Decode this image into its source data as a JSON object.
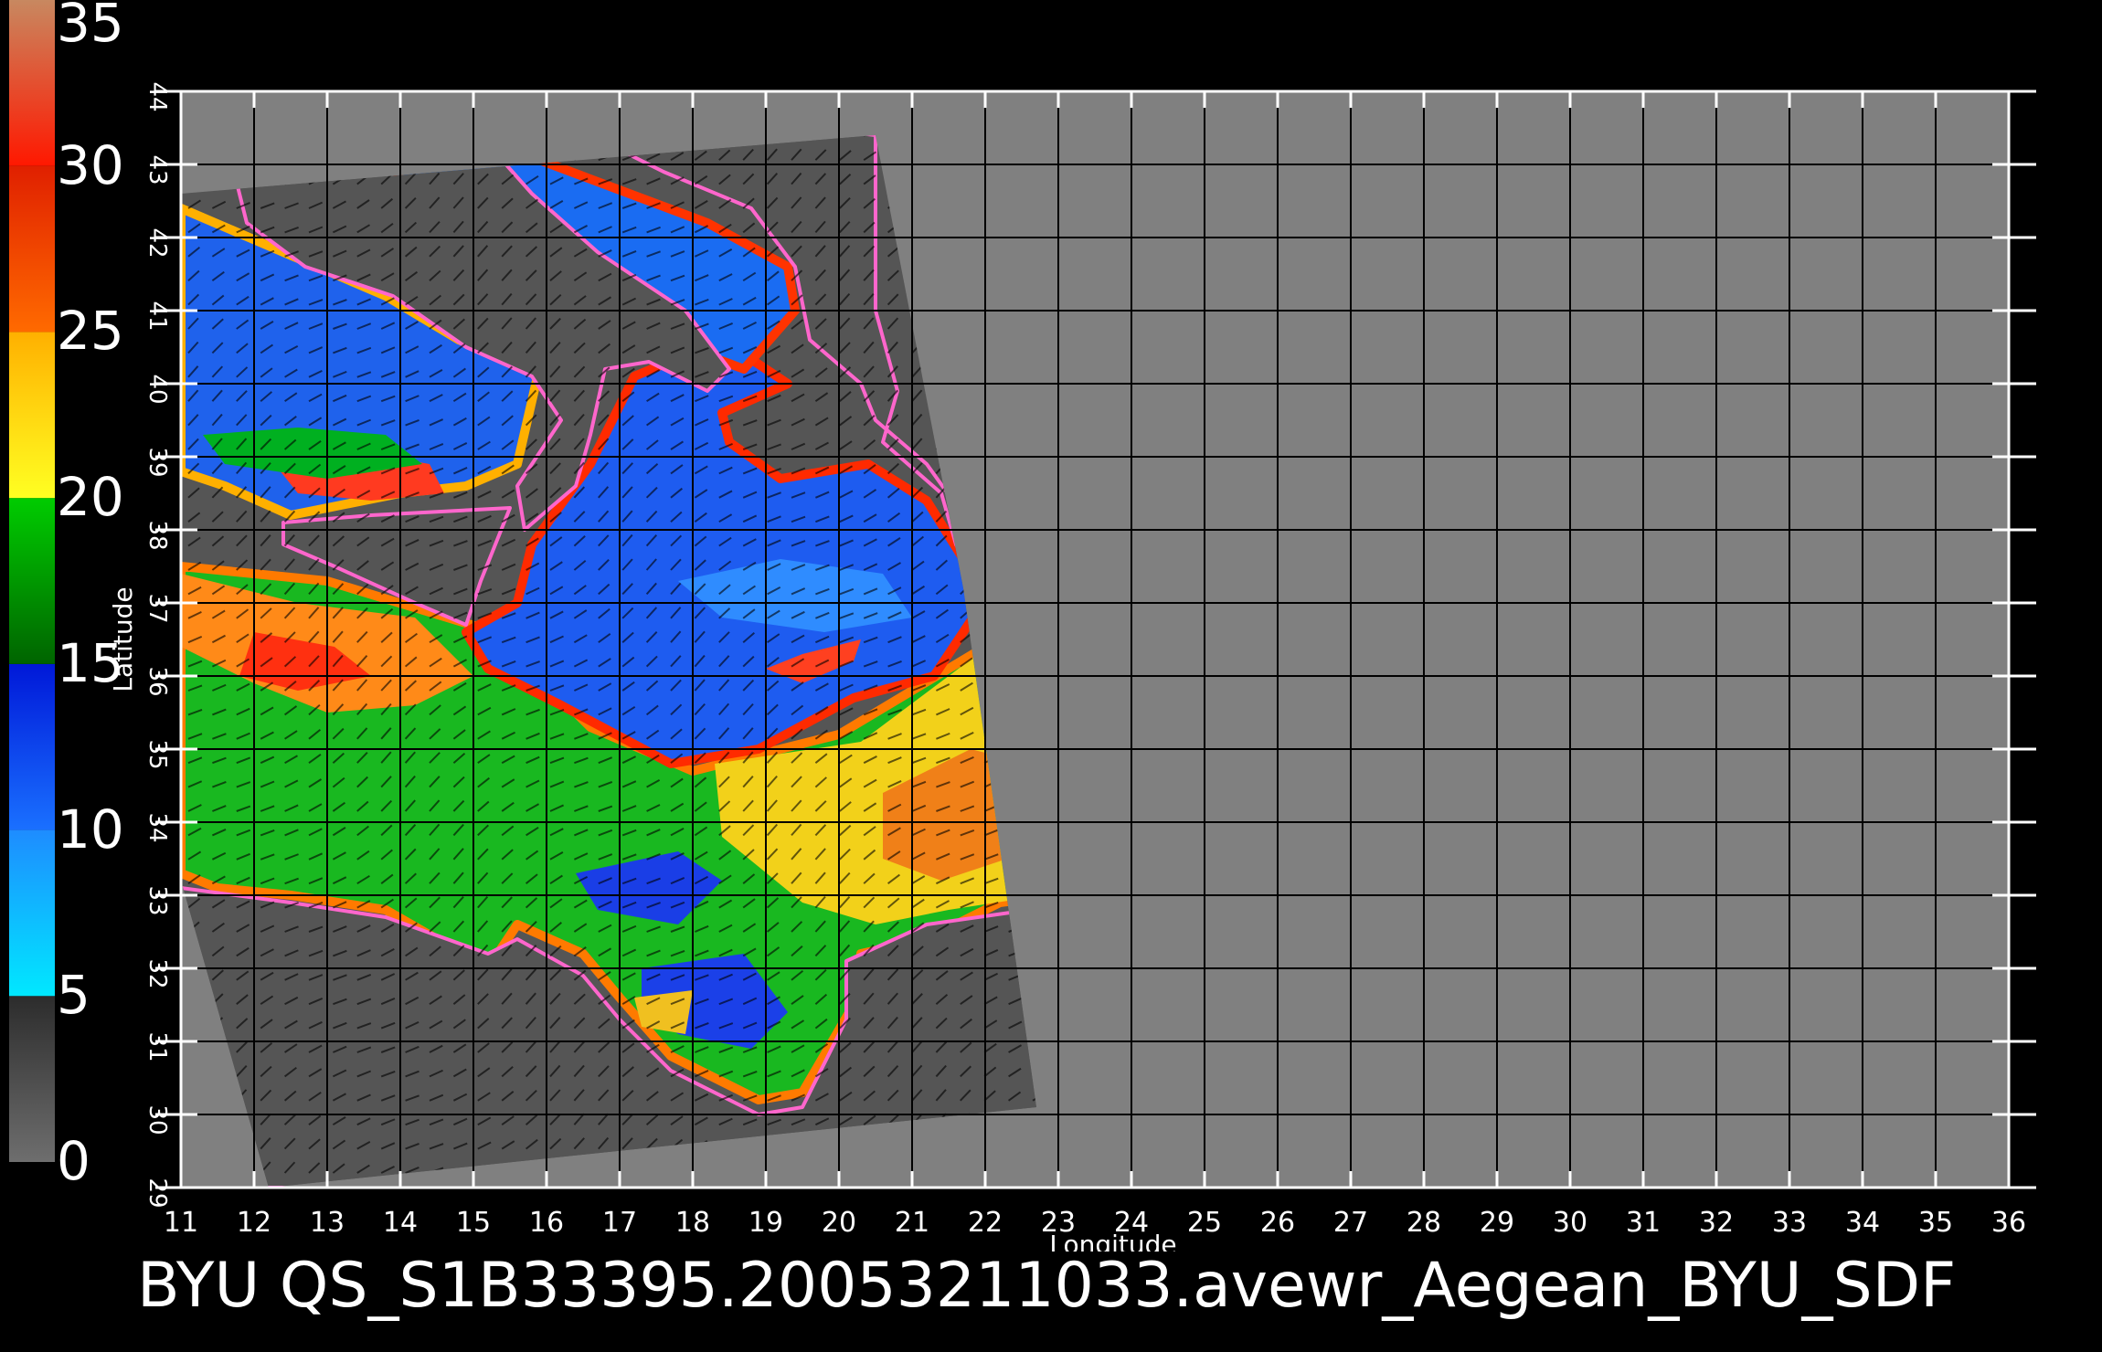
{
  "colorbar": {
    "labels": [
      "35",
      "30",
      "25",
      "20",
      "15",
      "10",
      "5",
      "0"
    ],
    "bands": [
      {
        "from": 0,
        "to": 5,
        "colors": [
          "#6e6e6e",
          "#2c2c2c"
        ]
      },
      {
        "from": 5,
        "to": 10,
        "colors": [
          "#00e8ff",
          "#1e8cff"
        ]
      },
      {
        "from": 10,
        "to": 15,
        "colors": [
          "#1a70ff",
          "#0018d8"
        ]
      },
      {
        "from": 15,
        "to": 20,
        "colors": [
          "#006400",
          "#00cc00"
        ]
      },
      {
        "from": 20,
        "to": 25,
        "colors": [
          "#ffff22",
          "#ffb000"
        ]
      },
      {
        "from": 25,
        "to": 30,
        "colors": [
          "#ff6a00",
          "#e02000"
        ]
      },
      {
        "from": 30,
        "to": 35,
        "colors": [
          "#ff1800",
          "#c88860"
        ]
      }
    ]
  },
  "map": {
    "lon_range": [
      11,
      36
    ],
    "lat_range": [
      29,
      44
    ],
    "lon_ticks": [
      "11",
      "12",
      "13",
      "14",
      "15",
      "16",
      "17",
      "18",
      "19",
      "20",
      "21",
      "22",
      "23",
      "24",
      "25",
      "26",
      "27",
      "28",
      "29",
      "30",
      "31",
      "32",
      "33",
      "34",
      "35",
      "36"
    ],
    "lat_ticks": [
      "29",
      "30",
      "31",
      "32",
      "33",
      "34",
      "35",
      "36",
      "37",
      "38",
      "39",
      "40",
      "41",
      "42",
      "43",
      "44"
    ],
    "xlabel": "Longitude",
    "ylabel": "Latitude",
    "colors": {
      "nodata": "#808080",
      "swath_land": "#555555",
      "grid": "#000000"
    }
  },
  "title": "BYU  QS_S1B33395.20053211033.avewr_Aegean_BYU_SDF"
}
